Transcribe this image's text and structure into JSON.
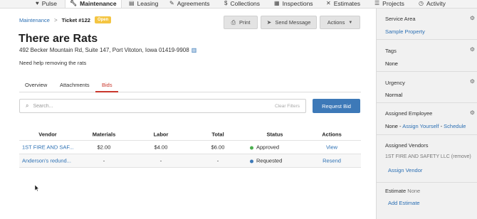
{
  "nav": {
    "tabs": [
      {
        "label": "Pulse",
        "icon": "heartbeat-icon",
        "active": false
      },
      {
        "label": "Maintenance",
        "icon": "wrench-icon",
        "active": true
      },
      {
        "label": "Leasing",
        "icon": "document-icon",
        "active": false
      },
      {
        "label": "Agreements",
        "icon": "pen-icon",
        "active": false
      },
      {
        "label": "Collections",
        "icon": "money-icon",
        "active": false
      },
      {
        "label": "Inspections",
        "icon": "clipboard-icon",
        "active": false
      },
      {
        "label": "Estimates",
        "icon": "tools-icon",
        "active": false
      },
      {
        "label": "Projects",
        "icon": "list-icon",
        "active": false
      },
      {
        "label": "Activity",
        "icon": "clock-icon",
        "active": false
      }
    ]
  },
  "breadcrumb": {
    "parent": "Maintenance",
    "separator": ">",
    "ticket": "Ticket #122",
    "status": "Open"
  },
  "actions": {
    "print": "Print",
    "send_message": "Send Message",
    "actions": "Actions"
  },
  "ticket": {
    "title": "There are Rats",
    "address": "492 Becker Mountain Rd, Suite 147, Port Vitoton, Iowa 01419-9908",
    "description": "Need help removing the rats"
  },
  "tabs": {
    "overview": "Overview",
    "attachments": "Attachments",
    "bids": "Bids"
  },
  "search": {
    "placeholder": "Search...",
    "clear": "Clear Filters",
    "request_bid": "Request Bid"
  },
  "bids_table": {
    "headers": {
      "vendor": "Vendor",
      "materials": "Materials",
      "labor": "Labor",
      "total": "Total",
      "status": "Status",
      "actions": "Actions"
    },
    "rows": [
      {
        "vendor": "1ST FIRE AND SAF...",
        "materials": "$2.00",
        "labor": "$4.00",
        "total": "$6.00",
        "status": "Approved",
        "status_color": "#4caf50",
        "action": "View"
      },
      {
        "vendor": "Anderson's redund...",
        "materials": "-",
        "labor": "-",
        "total": "-",
        "status": "Requested",
        "status_color": "#3d79b8",
        "action": "Resend"
      }
    ]
  },
  "sidebar": {
    "service_area": {
      "title": "Service Area",
      "value": "Sample Property"
    },
    "tags": {
      "title": "Tags",
      "value": "None"
    },
    "urgency": {
      "title": "Urgency",
      "value": "Normal"
    },
    "assigned_employee": {
      "title": "Assigned Employee",
      "value": "None",
      "sep1": " - ",
      "assign_yourself": "Assign Yourself",
      "sep2": " - ",
      "schedule": "Schedule"
    },
    "assigned_vendors": {
      "title": "Assigned Vendors",
      "vendor": "1ST FIRE AND SAFETY LLC",
      "remove": "(remove)",
      "assign": "Assign Vendor"
    },
    "estimate": {
      "title": "Estimate",
      "value": "None",
      "add": "Add Estimate"
    }
  }
}
